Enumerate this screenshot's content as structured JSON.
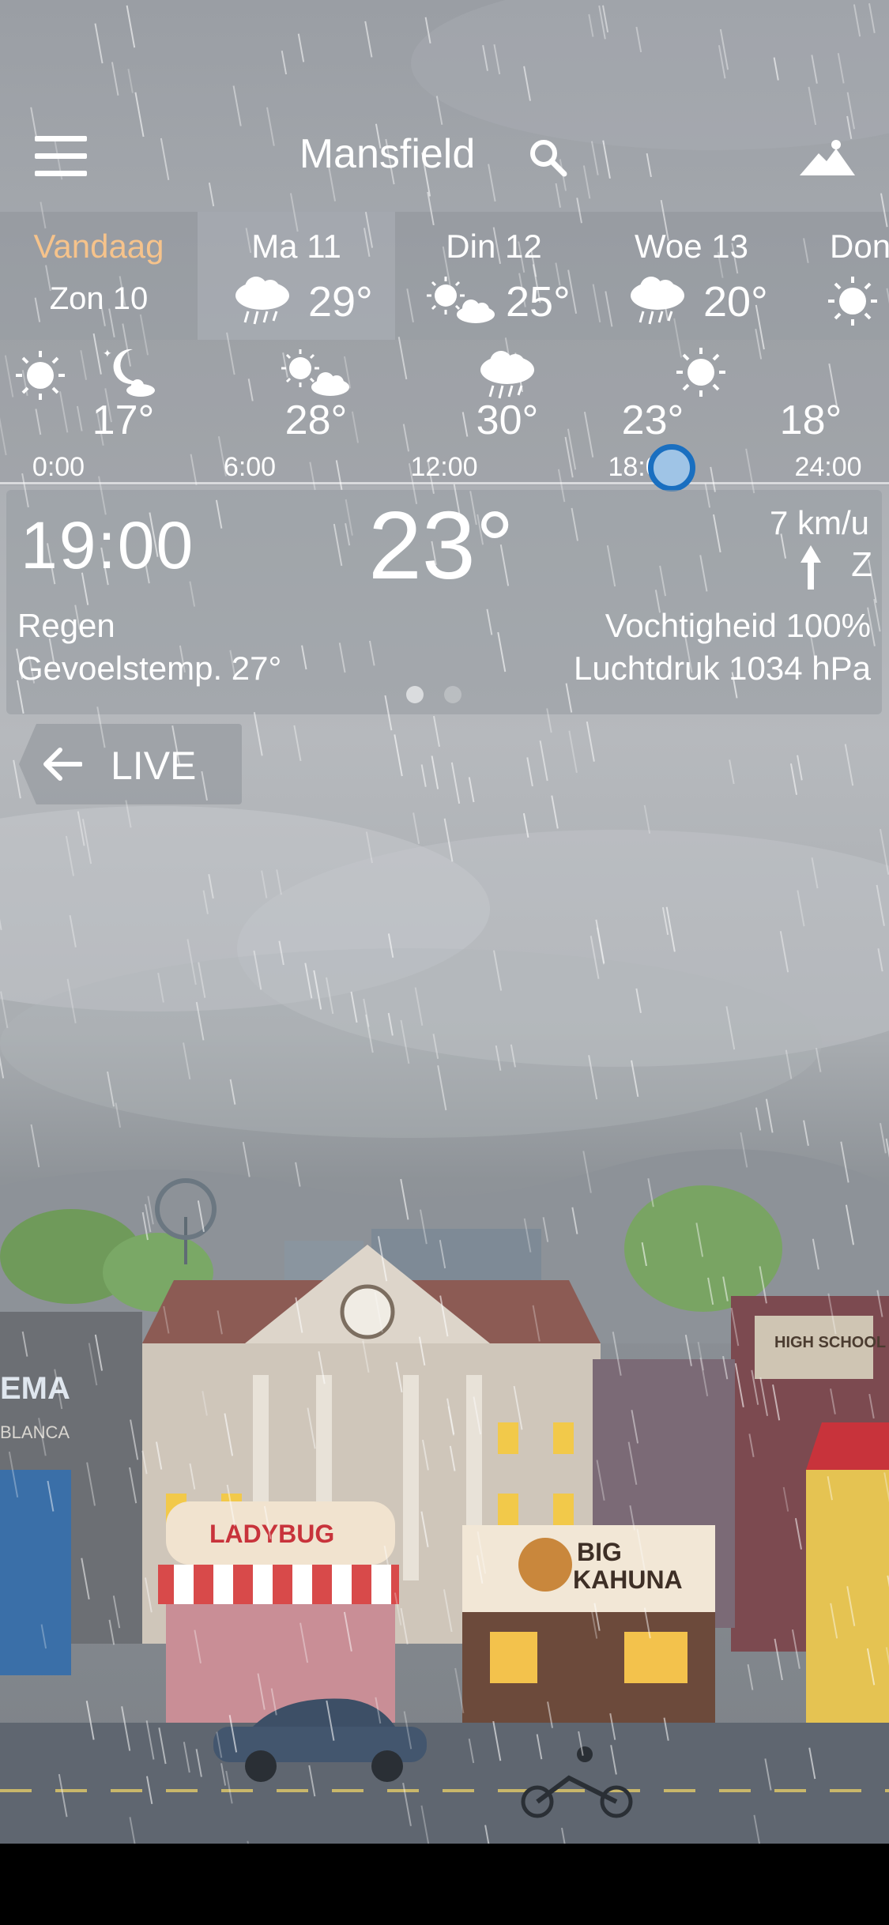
{
  "header": {
    "city": "Mansfield"
  },
  "days": [
    {
      "name": "Vandaag",
      "sub": "Zon 10",
      "icon": "none",
      "temp": ""
    },
    {
      "name": "Ma 11",
      "icon": "rain-cloud-icon",
      "temp": "29°"
    },
    {
      "name": "Din 12",
      "icon": "sun-cloud-icon",
      "temp": "25°"
    },
    {
      "name": "Woe 13",
      "icon": "rain-cloud-icon",
      "temp": "20°"
    },
    {
      "name": "Don",
      "icon": "sun-icon",
      "temp": ""
    }
  ],
  "hourly": {
    "temps": [
      "17°",
      "28°",
      "30°",
      "23°",
      "18°"
    ],
    "labels": [
      "0:00",
      "6:00",
      "12:00",
      "18:00",
      "24:00"
    ]
  },
  "detail": {
    "time": "19:00",
    "temp": "23°",
    "wind_speed": "7 km/u",
    "wind_dir": "Z",
    "condition": "Regen",
    "feels_like": "Gevoelstemp. 27°",
    "humidity": "Vochtigheid 100%",
    "pressure": "Luchtdruk 1034 hPa"
  },
  "live_button": "LIVE",
  "town_signs": {
    "ladybug": "LADYBUG",
    "bigkahuna_1": "BIG",
    "bigkahuna_2": "KAHUNA",
    "highschool": "HIGH SCHOOL",
    "cinema": "EMA",
    "casablanca": "BLANCA"
  },
  "colors": {
    "today": "#f6c38b",
    "knob_ring": "#1a6fc0",
    "knob_fill": "#9fc4e6"
  }
}
